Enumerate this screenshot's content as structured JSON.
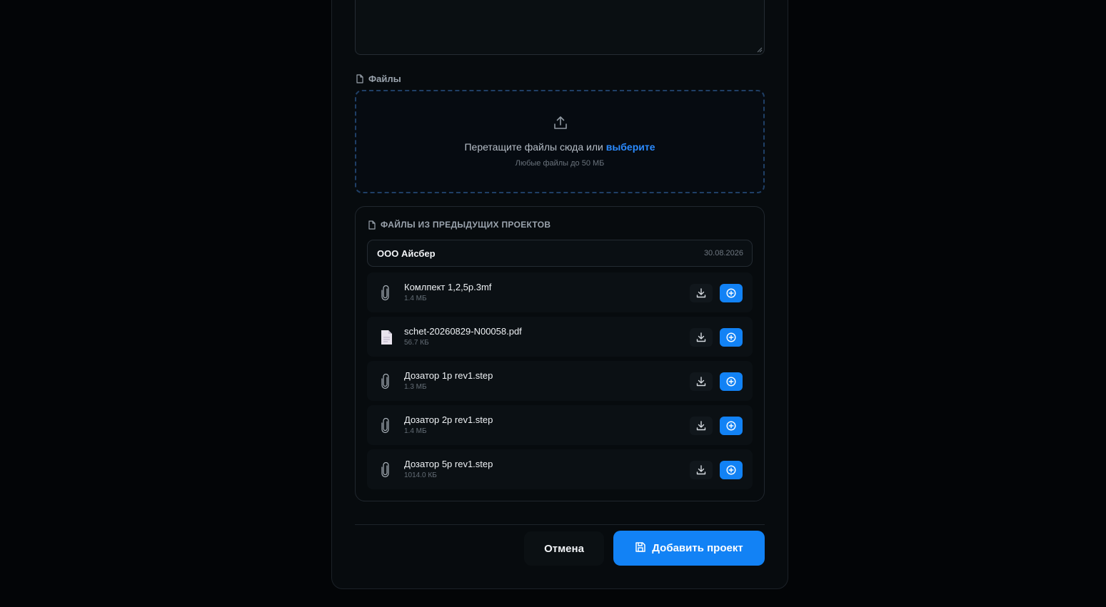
{
  "files_section": {
    "label": "Файлы",
    "icon": "file-icon"
  },
  "dropzone": {
    "text": "Перетащите файлы сюда или",
    "link": "выберите",
    "hint": "Любые файлы до 50 МБ",
    "icon": "upload-icon"
  },
  "previous": {
    "title": "ФАЙЛЫ ИЗ ПРЕДЫДУЩИХ ПРОЕКТОВ",
    "project": {
      "name": "ООО Айсбер",
      "date": "30.08.2026"
    },
    "files": [
      {
        "name": "Комлпект 1,2,5р.3mf",
        "size": "1.4 МБ",
        "icon": "paperclip-icon"
      },
      {
        "name": "schet-20260829-N00058.pdf",
        "size": "56.7 КБ",
        "icon": "document-icon"
      },
      {
        "name": "Дозатор 1р rev1.step",
        "size": "1.3 МБ",
        "icon": "paperclip-icon"
      },
      {
        "name": "Дозатор 2р rev1.step",
        "size": "1.4 МБ",
        "icon": "paperclip-icon"
      },
      {
        "name": "Дозатор 5р rev1.step",
        "size": "1014.0 КБ",
        "icon": "paperclip-icon"
      }
    ]
  },
  "actions": {
    "cancel": "Отмена",
    "submit": "Добавить проект",
    "submit_icon": "save-icon"
  },
  "colors": {
    "accent": "#1282f5",
    "link": "#2b8bff",
    "background": "#030507"
  }
}
